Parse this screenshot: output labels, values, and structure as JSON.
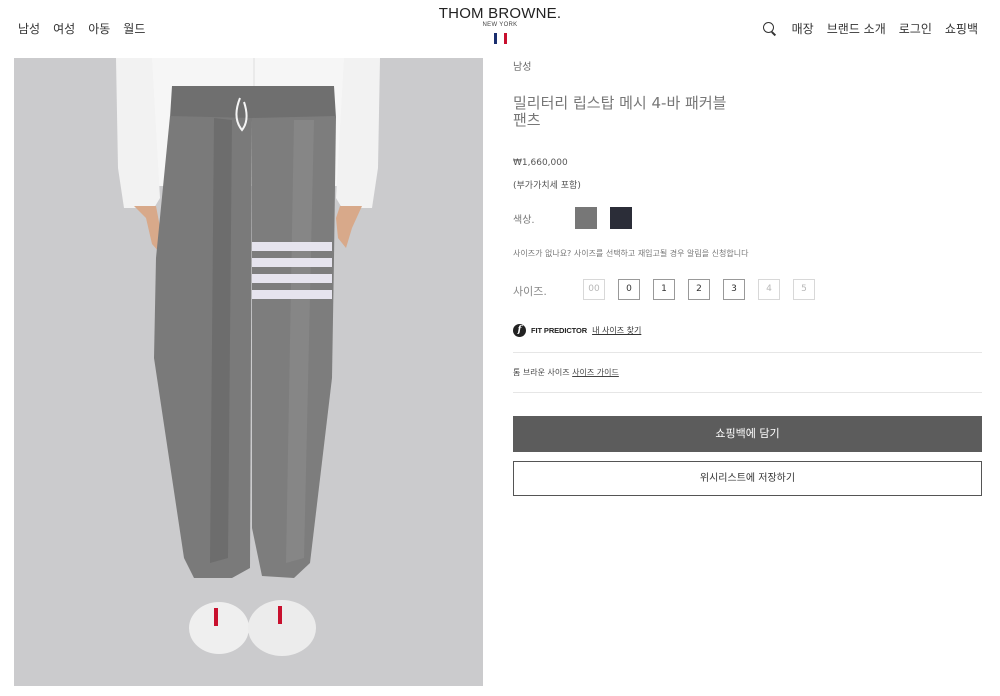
{
  "header": {
    "nav_left": [
      "남성",
      "여성",
      "아동",
      "월드"
    ],
    "brand": "THOM BROWNE.",
    "brand_sub": "NEW YORK",
    "nav_right": [
      "매장",
      "브랜드 소개",
      "로그인",
      "쇼핑백"
    ],
    "flag_colors": [
      "#1a2e6e",
      "#ffffff",
      "#c8102e"
    ]
  },
  "product": {
    "category": "남성",
    "title": "밀리터리 립스탑 메시 4-바 패커블 팬츠",
    "price": "₩1,660,000",
    "vat_note": "(부가가치세 포함)",
    "color_label": "색상.",
    "colors": [
      {
        "name": "gray",
        "hex": "#777777"
      },
      {
        "name": "navy",
        "hex": "#2b2d38"
      }
    ],
    "size_notice": "사이즈가 없나요? 사이즈를 선택하고 재입고될 경우 알림을 신청합니다",
    "size_label": "사이즈.",
    "sizes": [
      {
        "label": "00",
        "available": false
      },
      {
        "label": "0",
        "available": true
      },
      {
        "label": "1",
        "available": true
      },
      {
        "label": "2",
        "available": true
      },
      {
        "label": "3",
        "available": true
      },
      {
        "label": "4",
        "available": false
      },
      {
        "label": "5",
        "available": false
      }
    ],
    "fit_predictor_brand": "FIT PREDICTOR",
    "fit_predictor_link": "내 사이즈 찾기",
    "size_guide_prefix": "톰 브라운 사이즈",
    "size_guide_link": "사이즈 가이드",
    "add_to_cart": "쇼핑백에 담기",
    "add_to_wishlist": "위시리스트에 저장하기"
  }
}
